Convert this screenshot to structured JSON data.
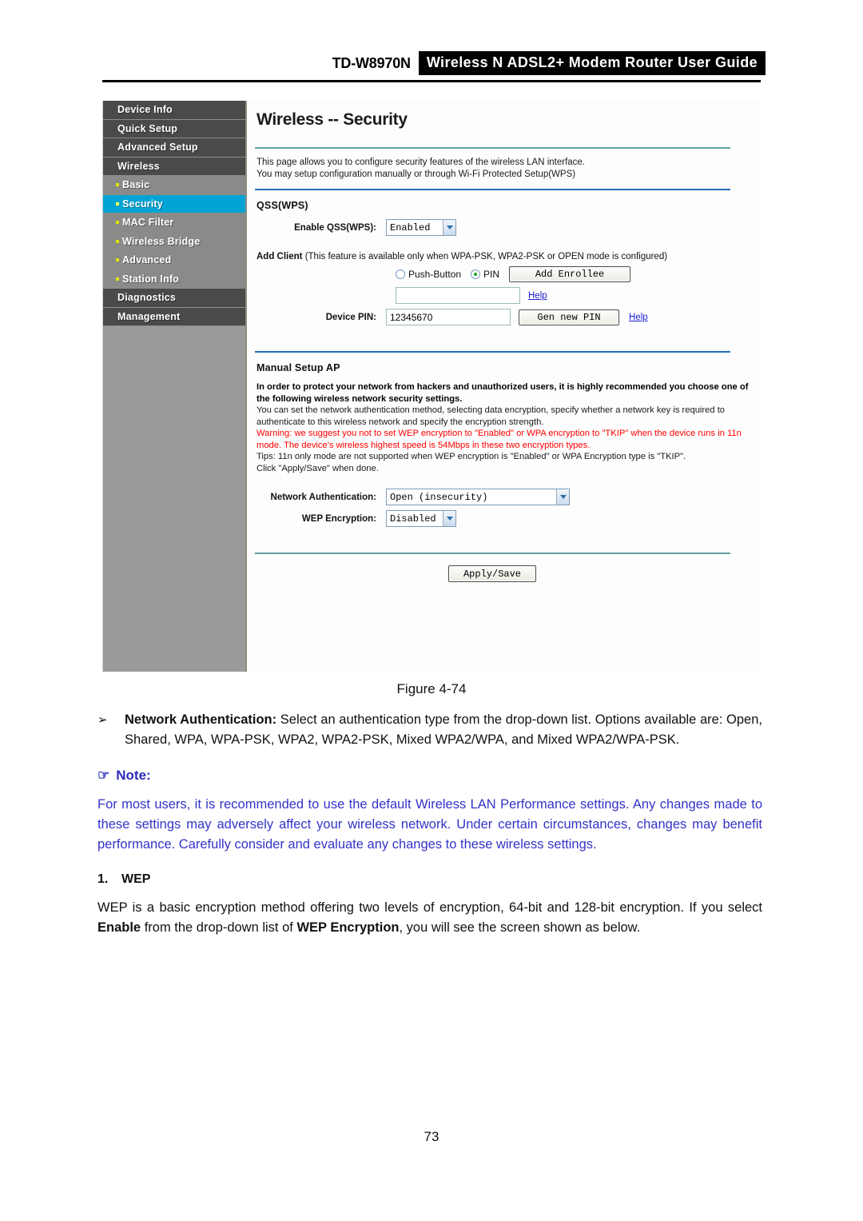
{
  "header": {
    "model": "TD-W8970N",
    "title": "Wireless N ADSL2+ Modem Router User Guide"
  },
  "figure": {
    "caption": "Figure 4-74",
    "sidebar": {
      "items": [
        {
          "label": "Device Info",
          "level": "top",
          "active": false
        },
        {
          "label": "Quick Setup",
          "level": "top",
          "active": false
        },
        {
          "label": "Advanced Setup",
          "level": "top",
          "active": false
        },
        {
          "label": "Wireless",
          "level": "top",
          "active": false
        },
        {
          "label": "Basic",
          "level": "sub",
          "active": false
        },
        {
          "label": "Security",
          "level": "sub",
          "active": true
        },
        {
          "label": "MAC Filter",
          "level": "sub",
          "active": false
        },
        {
          "label": "Wireless Bridge",
          "level": "sub",
          "active": false
        },
        {
          "label": "Advanced",
          "level": "sub",
          "active": false
        },
        {
          "label": "Station Info",
          "level": "sub",
          "active": false
        },
        {
          "label": "Diagnostics",
          "level": "top",
          "active": false
        },
        {
          "label": "Management",
          "level": "top",
          "active": false
        }
      ]
    },
    "content": {
      "title": "Wireless -- Security",
      "intro_line1": "This page allows you to configure security features of the wireless LAN interface.",
      "intro_line2": "You may setup configuration manually or through Wi-Fi Protected Setup(WPS)",
      "qss": {
        "heading": "QSS(WPS)",
        "enable_label": "Enable QSS(WPS):",
        "enable_value": "Enabled",
        "add_client_bold": "Add Client",
        "add_client_rest": " (This feature is available only when WPA-PSK, WPA2-PSK or OPEN mode is configured)",
        "push_button_label": "Push-Button",
        "pin_label": "PIN",
        "push_button_selected": false,
        "pin_selected": true,
        "add_enrollee_label": "Add Enrollee",
        "pin_input_value": "",
        "help_label": "Help",
        "device_pin_label": "Device PIN:",
        "device_pin_value": "12345670",
        "gen_new_pin_label": "Gen new PIN",
        "help_label2": "Help"
      },
      "manual": {
        "heading": "Manual Setup AP",
        "paragraphs": [
          {
            "text": "In order to protect your network from hackers and unauthorized users, it is highly recommended you choose one of the following wireless network security settings.",
            "style": "bold"
          },
          {
            "text": "You can set the network authentication method, selecting data encryption, specify whether a network key is required to authenticate to this wireless network and specify the encryption strength.",
            "style": "normal"
          },
          {
            "text": "Warning: we suggest you not to set WEP encryption to \"Enabled\" or WPA encryption to \"TKIP\" when the device runs in 11n mode. The device's wireless highest speed is 54Mbps in these two encryption types.",
            "style": "warn"
          },
          {
            "text": "Tips: 11n only mode are not supported when WEP encryption is \"Enabled\" or WPA Encryption type is \"TKIP\".",
            "style": "normal"
          },
          {
            "text": "Click \"Apply/Save\" when done.",
            "style": "normal"
          }
        ],
        "network_auth_label": "Network Authentication:",
        "network_auth_value": "Open (insecurity)",
        "wep_encryption_label": "WEP Encryption:",
        "wep_encryption_value": "Disabled",
        "apply_save_label": "Apply/Save"
      }
    }
  },
  "doc": {
    "bullet_glyph": "➢",
    "bullet_term": "Network Authentication:",
    "bullet_text": " Select an authentication type from the drop-down list. Options available are: Open, Shared, WPA, WPA-PSK, WPA2, WPA2-PSK, Mixed WPA2/WPA, and Mixed WPA2/WPA-PSK.",
    "note_hand": "☞",
    "note_label": "Note:",
    "note_body": "For most users, it is recommended to use the default Wireless LAN Performance settings. Any changes made to these settings may adversely affect your wireless network. Under certain circumstances, changes may benefit performance. Carefully consider and evaluate any changes to these wireless settings.",
    "section_number": "1.",
    "section_title": "WEP",
    "section_body_1": "WEP is a basic encryption method offering two levels of encryption, 64-bit and 128-bit encryption. If you select ",
    "section_body_b1": "Enable",
    "section_body_2": " from the drop-down list of ",
    "section_body_b2": "WEP Encryption",
    "section_body_3": ", you will see the screen shown as below.",
    "page_number": "73"
  }
}
